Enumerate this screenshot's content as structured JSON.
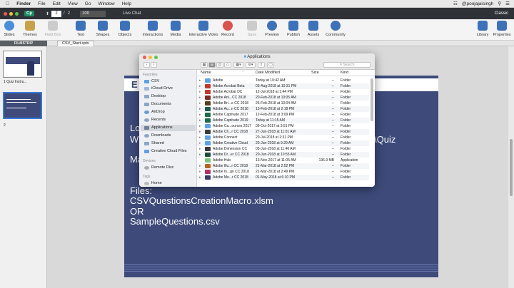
{
  "menubar": {
    "app": "Finder",
    "items": [
      "File",
      "Edit",
      "View",
      "Go",
      "Window",
      "Help"
    ],
    "user": "@poojajaisingh"
  },
  "captivate_bar": {
    "logo": "Cp",
    "page_current": "2",
    "page_sep": "/",
    "page_total": "2",
    "zoom": "100",
    "mode": "Live Chat",
    "view": "Classic"
  },
  "toolbar": {
    "buttons": [
      {
        "label": "Slides",
        "color": "#4a8fd8"
      },
      {
        "label": "Themes",
        "color": "#c8a24a"
      },
      {
        "label": "Field Box",
        "color": "#cccccc"
      },
      {
        "label": "Text",
        "color": "#3d72b8"
      },
      {
        "label": "Shapes",
        "color": "#3d72b8"
      },
      {
        "label": "Objects",
        "color": "#3d72b8"
      },
      {
        "label": "Interactions",
        "color": "#3d72b8"
      },
      {
        "label": "Media",
        "color": "#3d72b8"
      },
      {
        "label": "Interactive Video",
        "color": "#3d72b8"
      },
      {
        "label": "Record",
        "color": "#d9534f"
      },
      {
        "label": "Save",
        "color": "#cccccc"
      },
      {
        "label": "Preview",
        "color": "#3d72b8"
      },
      {
        "label": "Publish",
        "color": "#3d72b8"
      },
      {
        "label": "Assets",
        "color": "#3d72b8"
      },
      {
        "label": "Community",
        "color": "#3d72b8"
      },
      {
        "label": "Library",
        "color": "#3d72b8"
      },
      {
        "label": "Properties",
        "color": "#3d72b8"
      }
    ]
  },
  "filmstrip": {
    "header": "FILMSTRIP",
    "slide1_label": "1 Quiz Instru...",
    "slide2_label": "2"
  },
  "document_tab": "CSV_Start.cptx",
  "slide": {
    "title_partial": "E",
    "line1": "Lo",
    "line2": "Wi",
    "line2_end": "\\Quiz",
    "line3": "Ma",
    "files_label": "Files:",
    "file1": "CSVQuestionsCreationMacro.xlsm",
    "or_label": "OR",
    "file2": "SampleQuestions.csv"
  },
  "finder": {
    "title": "Applications",
    "search_placeholder": "Search",
    "sidebar": {
      "favorites_header": "Favorites",
      "favorites": [
        "CSV",
        "iCloud Drive",
        "Desktop",
        "Documents",
        "AirDrop",
        "Recents",
        "Applications",
        "Downloads",
        "Shared",
        "Creative Cloud Files"
      ],
      "devices_header": "Devices",
      "devices": [
        "Remote Disc"
      ],
      "tags_header": "Tags",
      "tags": [
        "Home"
      ]
    },
    "columns": [
      "Name",
      "Date Modified",
      "Size",
      "Kind"
    ],
    "rows": [
      {
        "name": "Adobe",
        "date": "Today at 10:42 AM",
        "size": "--",
        "kind": "Folder",
        "icon": "#5ea1e6"
      },
      {
        "name": "Adobe Acrobat Beta",
        "date": "03-Aug-2018 at 10:31 PM",
        "size": "--",
        "kind": "Folder",
        "icon": "#c0392b"
      },
      {
        "name": "Adobe Acrobat DC",
        "date": "12-Jul-2018 at 1:44 PM",
        "size": "--",
        "kind": "Folder",
        "icon": "#c0392b"
      },
      {
        "name": "Adobe Ani...CC 2018",
        "date": "20-Feb-2018 at 10:05 AM",
        "size": "--",
        "kind": "Folder",
        "icon": "#7a2c1f"
      },
      {
        "name": "Adobe Bri...e CC 2018",
        "date": "26-Feb-2018 at 10:04 AM",
        "size": "--",
        "kind": "Folder",
        "icon": "#5a3d1a"
      },
      {
        "name": "Adobe Au...n CC 2018",
        "date": "13-Feb-2018 at 2:18 PM",
        "size": "--",
        "kind": "Folder",
        "icon": "#1f5a4a"
      },
      {
        "name": "Adobe Captivate 2017",
        "date": "12-Feb-2018 at 3:09 PM",
        "size": "--",
        "kind": "Folder",
        "icon": "#1b6b4a"
      },
      {
        "name": "Adobe Captivate 2019",
        "date": "Today at 11:15 AM",
        "size": "--",
        "kind": "Folder",
        "icon": "#1b6b4a"
      },
      {
        "name": "Adobe Ca...ources 2017",
        "date": "09-Oct-2017 at 3:51 PM",
        "size": "--",
        "kind": "Folder",
        "icon": "#5ea1e6"
      },
      {
        "name": "Adobe Ch...r CC 2018",
        "date": "27-Jun-2018 at 11:01 AM",
        "size": "--",
        "kind": "Folder",
        "icon": "#3a3a3a"
      },
      {
        "name": "Adobe Connect",
        "date": "20-Jul-2018 at 2:31 PM",
        "size": "--",
        "kind": "Folder",
        "icon": "#5ea1e6"
      },
      {
        "name": "Adobe Creative Cloud",
        "date": "20-Jun-2018 at 9:29 AM",
        "size": "--",
        "kind": "Folder",
        "icon": "#5ea1e6"
      },
      {
        "name": "Adobe Dimension CC",
        "date": "05-Jun-2018 at 11:46 AM",
        "size": "--",
        "kind": "Folder",
        "icon": "#3a3a3a"
      },
      {
        "name": "Adobe Dr...er CC 2018",
        "date": "20-Jun-2018 at 10:55 AM",
        "size": "--",
        "kind": "Folder",
        "icon": "#1f4a3a"
      },
      {
        "name": "Adobe Hub",
        "date": "13-Nov-2017 at 11:05 AM",
        "size": "136.9 MB",
        "kind": "Application",
        "icon": "#7bc47f"
      },
      {
        "name": "Adobe Illu...r CC 2018",
        "date": "21-Mar-2018 at 2:52 PM",
        "size": "--",
        "kind": "Folder",
        "icon": "#b5651d"
      },
      {
        "name": "Adobe In...gn CC 2018",
        "date": "21-Mar-2018 at 2:49 PM",
        "size": "--",
        "kind": "Folder",
        "icon": "#b0306b"
      },
      {
        "name": "Adobe Me...r CC 2018",
        "date": "01-May-2018 at 6:10 PM",
        "size": "--",
        "kind": "Folder",
        "icon": "#3a3a6a"
      }
    ]
  }
}
